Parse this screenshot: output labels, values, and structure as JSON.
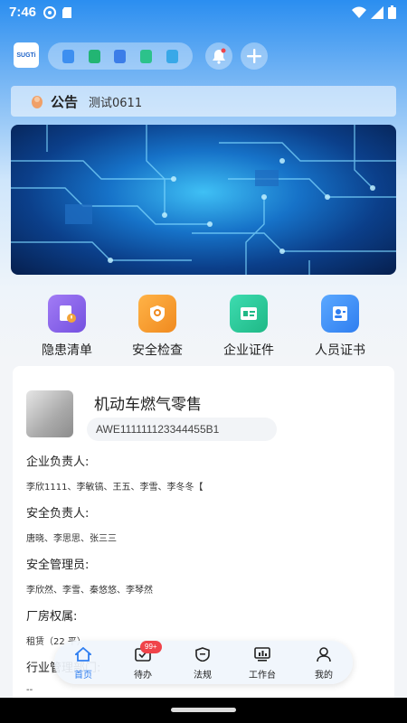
{
  "status_bar": {
    "time": "7:46"
  },
  "notice": {
    "title": "公告",
    "text": "测试0611"
  },
  "logo": {
    "text": "SUGTi"
  },
  "menu": [
    {
      "label": "隐患清单",
      "color": "#8a63ea"
    },
    {
      "label": "安全检查",
      "color": "#f79a2a"
    },
    {
      "label": "企业证件",
      "color": "#2bc99a"
    },
    {
      "label": "人员证书",
      "color": "#3b8cf2"
    }
  ],
  "company": {
    "name": "机动车燃气零售",
    "code": "AWE111111123344455B1",
    "fields": [
      {
        "label": "企业负责人:",
        "value": "李欣1111、李敏镐、王五、李雪、李冬冬【"
      },
      {
        "label": "安全负责人:",
        "value": "唐晓、李思思、张三三"
      },
      {
        "label": "安全管理员:",
        "value": "李欣然、李雪、秦悠悠、李琴然"
      },
      {
        "label": "厂房权属:",
        "value": "租赁（22 平）"
      },
      {
        "label": "行业管理部门:",
        "value": "--"
      }
    ]
  },
  "tabs": [
    {
      "label": "首页",
      "active": true
    },
    {
      "label": "待办",
      "badge": "99+"
    },
    {
      "label": "法规"
    },
    {
      "label": "工作台"
    },
    {
      "label": "我的"
    }
  ],
  "colors": {
    "accent": "#2f7ef0",
    "badge": "#f0434a"
  }
}
